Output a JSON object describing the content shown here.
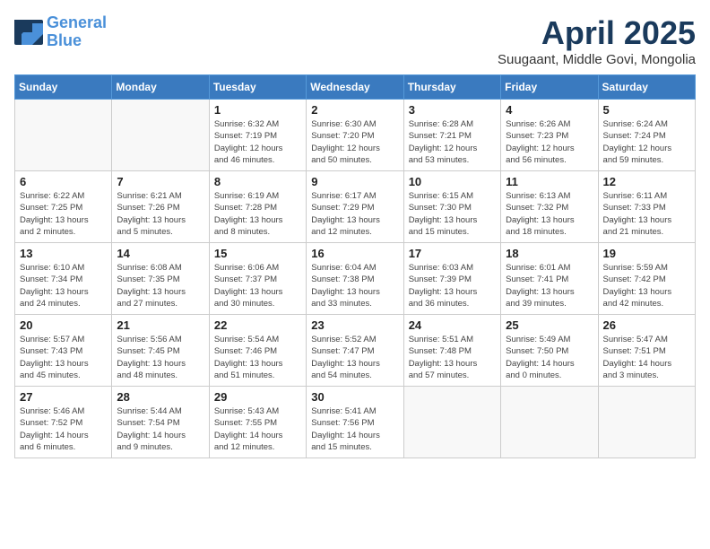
{
  "header": {
    "logo_line1": "General",
    "logo_line2": "Blue",
    "month": "April 2025",
    "location": "Suugaant, Middle Govi, Mongolia"
  },
  "weekdays": [
    "Sunday",
    "Monday",
    "Tuesday",
    "Wednesday",
    "Thursday",
    "Friday",
    "Saturday"
  ],
  "weeks": [
    [
      {
        "day": "",
        "info": ""
      },
      {
        "day": "",
        "info": ""
      },
      {
        "day": "1",
        "info": "Sunrise: 6:32 AM\nSunset: 7:19 PM\nDaylight: 12 hours\nand 46 minutes."
      },
      {
        "day": "2",
        "info": "Sunrise: 6:30 AM\nSunset: 7:20 PM\nDaylight: 12 hours\nand 50 minutes."
      },
      {
        "day": "3",
        "info": "Sunrise: 6:28 AM\nSunset: 7:21 PM\nDaylight: 12 hours\nand 53 minutes."
      },
      {
        "day": "4",
        "info": "Sunrise: 6:26 AM\nSunset: 7:23 PM\nDaylight: 12 hours\nand 56 minutes."
      },
      {
        "day": "5",
        "info": "Sunrise: 6:24 AM\nSunset: 7:24 PM\nDaylight: 12 hours\nand 59 minutes."
      }
    ],
    [
      {
        "day": "6",
        "info": "Sunrise: 6:22 AM\nSunset: 7:25 PM\nDaylight: 13 hours\nand 2 minutes."
      },
      {
        "day": "7",
        "info": "Sunrise: 6:21 AM\nSunset: 7:26 PM\nDaylight: 13 hours\nand 5 minutes."
      },
      {
        "day": "8",
        "info": "Sunrise: 6:19 AM\nSunset: 7:28 PM\nDaylight: 13 hours\nand 8 minutes."
      },
      {
        "day": "9",
        "info": "Sunrise: 6:17 AM\nSunset: 7:29 PM\nDaylight: 13 hours\nand 12 minutes."
      },
      {
        "day": "10",
        "info": "Sunrise: 6:15 AM\nSunset: 7:30 PM\nDaylight: 13 hours\nand 15 minutes."
      },
      {
        "day": "11",
        "info": "Sunrise: 6:13 AM\nSunset: 7:32 PM\nDaylight: 13 hours\nand 18 minutes."
      },
      {
        "day": "12",
        "info": "Sunrise: 6:11 AM\nSunset: 7:33 PM\nDaylight: 13 hours\nand 21 minutes."
      }
    ],
    [
      {
        "day": "13",
        "info": "Sunrise: 6:10 AM\nSunset: 7:34 PM\nDaylight: 13 hours\nand 24 minutes."
      },
      {
        "day": "14",
        "info": "Sunrise: 6:08 AM\nSunset: 7:35 PM\nDaylight: 13 hours\nand 27 minutes."
      },
      {
        "day": "15",
        "info": "Sunrise: 6:06 AM\nSunset: 7:37 PM\nDaylight: 13 hours\nand 30 minutes."
      },
      {
        "day": "16",
        "info": "Sunrise: 6:04 AM\nSunset: 7:38 PM\nDaylight: 13 hours\nand 33 minutes."
      },
      {
        "day": "17",
        "info": "Sunrise: 6:03 AM\nSunset: 7:39 PM\nDaylight: 13 hours\nand 36 minutes."
      },
      {
        "day": "18",
        "info": "Sunrise: 6:01 AM\nSunset: 7:41 PM\nDaylight: 13 hours\nand 39 minutes."
      },
      {
        "day": "19",
        "info": "Sunrise: 5:59 AM\nSunset: 7:42 PM\nDaylight: 13 hours\nand 42 minutes."
      }
    ],
    [
      {
        "day": "20",
        "info": "Sunrise: 5:57 AM\nSunset: 7:43 PM\nDaylight: 13 hours\nand 45 minutes."
      },
      {
        "day": "21",
        "info": "Sunrise: 5:56 AM\nSunset: 7:45 PM\nDaylight: 13 hours\nand 48 minutes."
      },
      {
        "day": "22",
        "info": "Sunrise: 5:54 AM\nSunset: 7:46 PM\nDaylight: 13 hours\nand 51 minutes."
      },
      {
        "day": "23",
        "info": "Sunrise: 5:52 AM\nSunset: 7:47 PM\nDaylight: 13 hours\nand 54 minutes."
      },
      {
        "day": "24",
        "info": "Sunrise: 5:51 AM\nSunset: 7:48 PM\nDaylight: 13 hours\nand 57 minutes."
      },
      {
        "day": "25",
        "info": "Sunrise: 5:49 AM\nSunset: 7:50 PM\nDaylight: 14 hours\nand 0 minutes."
      },
      {
        "day": "26",
        "info": "Sunrise: 5:47 AM\nSunset: 7:51 PM\nDaylight: 14 hours\nand 3 minutes."
      }
    ],
    [
      {
        "day": "27",
        "info": "Sunrise: 5:46 AM\nSunset: 7:52 PM\nDaylight: 14 hours\nand 6 minutes."
      },
      {
        "day": "28",
        "info": "Sunrise: 5:44 AM\nSunset: 7:54 PM\nDaylight: 14 hours\nand 9 minutes."
      },
      {
        "day": "29",
        "info": "Sunrise: 5:43 AM\nSunset: 7:55 PM\nDaylight: 14 hours\nand 12 minutes."
      },
      {
        "day": "30",
        "info": "Sunrise: 5:41 AM\nSunset: 7:56 PM\nDaylight: 14 hours\nand 15 minutes."
      },
      {
        "day": "",
        "info": ""
      },
      {
        "day": "",
        "info": ""
      },
      {
        "day": "",
        "info": ""
      }
    ]
  ]
}
